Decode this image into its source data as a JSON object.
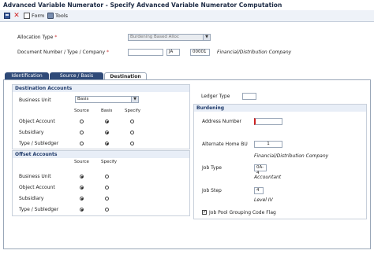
{
  "window": {
    "title": "Advanced Variable Numerator - Specify Advanced Variable Numerator Computation"
  },
  "toolbar": {
    "save_icon": "save-icon",
    "cancel_icon": "cancel-icon",
    "form_label": "Form",
    "tools_label": "Tools"
  },
  "header": {
    "allocation_type_label": "Allocation Type",
    "allocation_type_value": "Burdening Based Alloc",
    "document_label": "Document Number / Type / Company",
    "document_number": "",
    "document_type": "JA",
    "document_company": "00001",
    "company_name": "Financial/Distribution Company",
    "required_mark": "*"
  },
  "tabs": [
    {
      "label": "Identification",
      "active": false
    },
    {
      "label": "Source / Basis",
      "active": false
    },
    {
      "label": "Destination",
      "active": true
    }
  ],
  "destination_accounts": {
    "title": "Destination Accounts",
    "business_unit_label": "Business Unit",
    "business_unit_value": "Basis",
    "columns": [
      "Source",
      "Basis",
      "Specify"
    ],
    "rows": [
      {
        "label": "Object Account",
        "selected": "Basis"
      },
      {
        "label": "Subsidiary",
        "selected": "Basis"
      },
      {
        "label": "Type / Subledger",
        "selected": "Basis"
      }
    ]
  },
  "offset_accounts": {
    "title": "Offset Accounts",
    "columns": [
      "Source",
      "Specify"
    ],
    "rows": [
      {
        "label": "Business Unit",
        "selected": "Source"
      },
      {
        "label": "Object Account",
        "selected": "Source"
      },
      {
        "label": "Subsidiary",
        "selected": "Source"
      },
      {
        "label": "Type / Subledger",
        "selected": "Source"
      }
    ]
  },
  "ledger": {
    "label": "Ledger Type",
    "value": ""
  },
  "burdening": {
    "title": "Burdening",
    "address_number_label": "Address Number",
    "address_number_value": "",
    "alt_home_bu_label": "Alternate Home BU",
    "alt_home_bu_value": "1",
    "alt_home_bu_desc": "Financial/Distribution Company",
    "job_type_label": "Job Type",
    "job_type_value": "0A-4",
    "job_type_desc": "Accountant",
    "job_step_label": "Job Step",
    "job_step_value": "4",
    "job_step_desc": "Level IV",
    "job_pool_label": "Job Pool Grouping Code Flag",
    "job_pool_checked": true
  }
}
